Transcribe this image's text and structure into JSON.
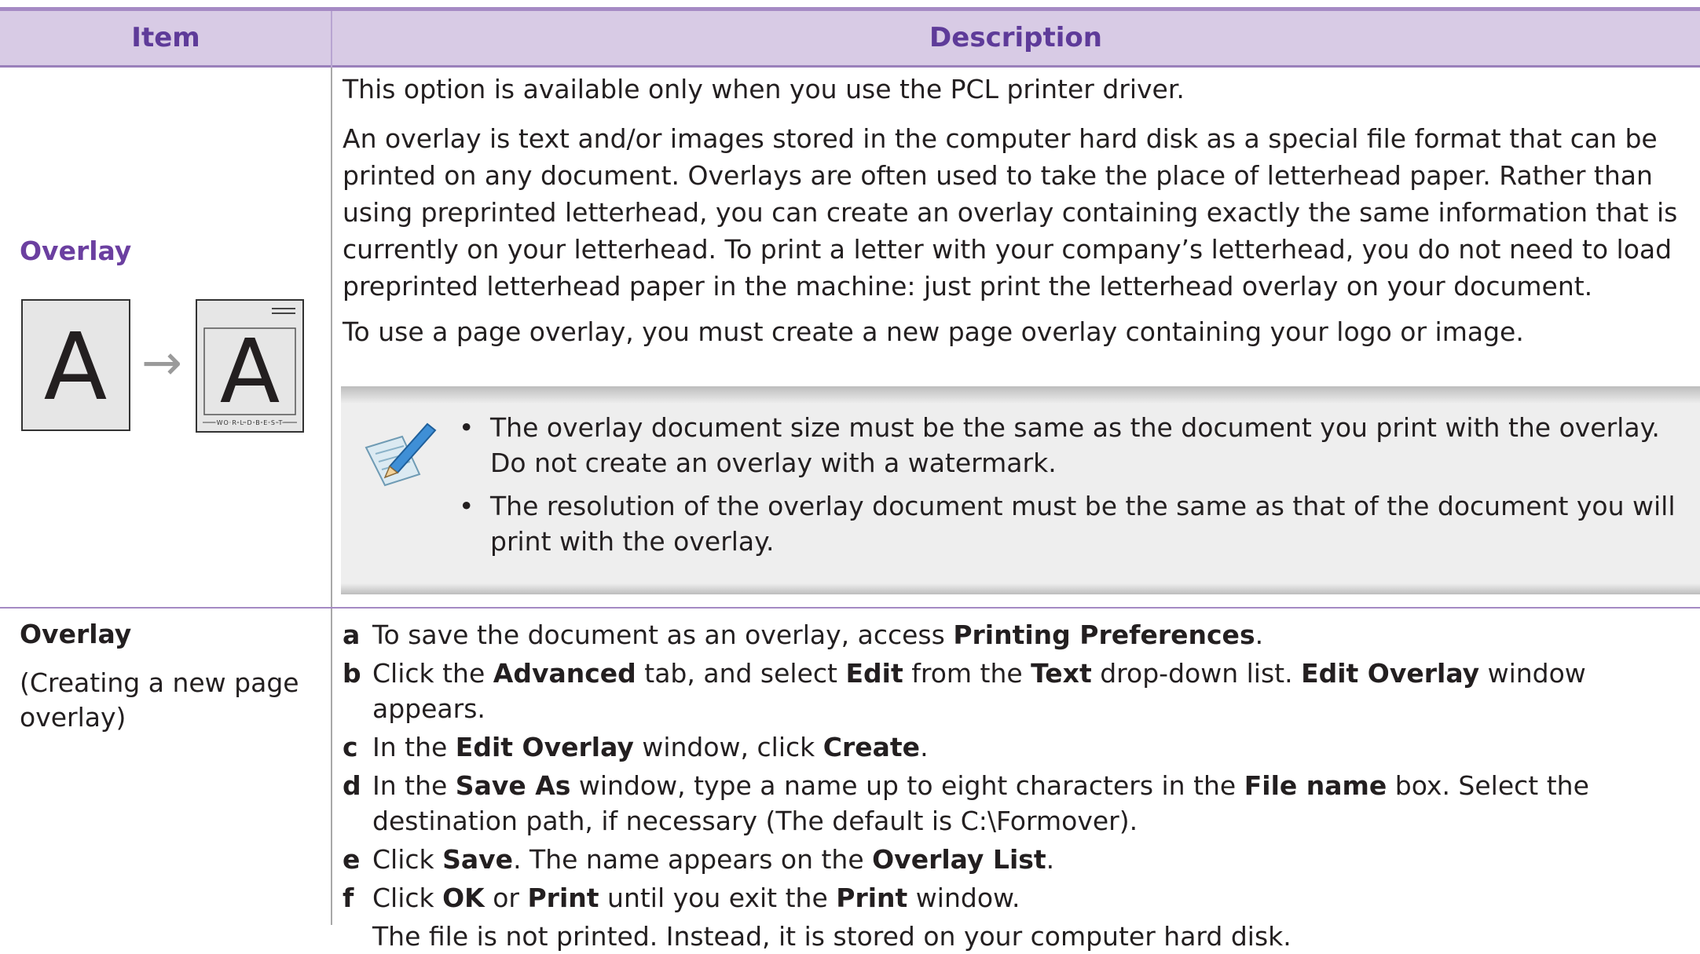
{
  "header": {
    "item": "Item",
    "description": "Description"
  },
  "overlay_row": {
    "title": "Overlay",
    "illustration": {
      "glyph_left": "A",
      "glyph_right": "A",
      "arrow": "→",
      "footer_text": "WO R L D B E S T"
    },
    "paragraphs": [
      "This option is available only when you use the PCL printer driver.",
      "An overlay is text and/or images stored in the computer hard disk as a special file format that can be printed on any document. Overlays are often used to take the place of letterhead paper. Rather than using preprinted letterhead, you can create an overlay containing exactly the same information that is currently on your letterhead. To print a letter with your company’s letterhead, you do not need to load preprinted letterhead paper in the machine: just print the letterhead overlay on your document.",
      "To use a page overlay, you must create a new page overlay containing your logo or image."
    ],
    "note": {
      "icon": "note-pencil-icon",
      "bullet": "•",
      "items": [
        "The overlay document size must be the same as the document you print with the overlay. Do not create an overlay with a watermark.",
        "The resolution of the overlay document must be the same as that of the document you will print with the overlay."
      ]
    }
  },
  "create_row": {
    "title": "Overlay",
    "subtitle": "(Creating a new page overlay)",
    "steps": [
      {
        "letter": "a",
        "parts": [
          [
            "To save the document as an overlay, access ",
            false
          ],
          [
            "Printing Preferences",
            true
          ],
          [
            ".",
            false
          ]
        ]
      },
      {
        "letter": "b",
        "parts": [
          [
            "Click the ",
            false
          ],
          [
            "Advanced",
            true
          ],
          [
            " tab, and select ",
            false
          ],
          [
            "Edit",
            true
          ],
          [
            " from the ",
            false
          ],
          [
            "Text",
            true
          ],
          [
            " drop-down list. ",
            false
          ],
          [
            "Edit Overlay",
            true
          ],
          [
            " window appears.",
            false
          ]
        ]
      },
      {
        "letter": "c",
        "parts": [
          [
            "In the ",
            false
          ],
          [
            "Edit Overlay",
            true
          ],
          [
            " window, click ",
            false
          ],
          [
            "Create",
            true
          ],
          [
            ".",
            false
          ]
        ]
      },
      {
        "letter": "d",
        "parts": [
          [
            "In the ",
            false
          ],
          [
            "Save As",
            true
          ],
          [
            " window, type a name up to eight characters in the ",
            false
          ],
          [
            "File name",
            true
          ],
          [
            " box. Select the destination path, if necessary (The default is C:\\Formover).",
            false
          ]
        ]
      },
      {
        "letter": "e",
        "parts": [
          [
            "Click ",
            false
          ],
          [
            "Save",
            true
          ],
          [
            ". The name appears on the ",
            false
          ],
          [
            "Overlay List",
            true
          ],
          [
            ".",
            false
          ]
        ]
      },
      {
        "letter": "f",
        "parts": [
          [
            "Click ",
            false
          ],
          [
            "OK",
            true
          ],
          [
            " or ",
            false
          ],
          [
            "Print",
            true
          ],
          [
            " until you exit the ",
            false
          ],
          [
            "Print",
            true
          ],
          [
            " window.",
            false
          ]
        ]
      }
    ],
    "final_note": "The file is not printed. Instead, it is stored on your computer hard disk."
  },
  "colors": {
    "header_bg": "#d8cbe5",
    "header_text": "#5e3b99",
    "accent": "#6b3fa0",
    "note_bg": "#eeeeee"
  }
}
